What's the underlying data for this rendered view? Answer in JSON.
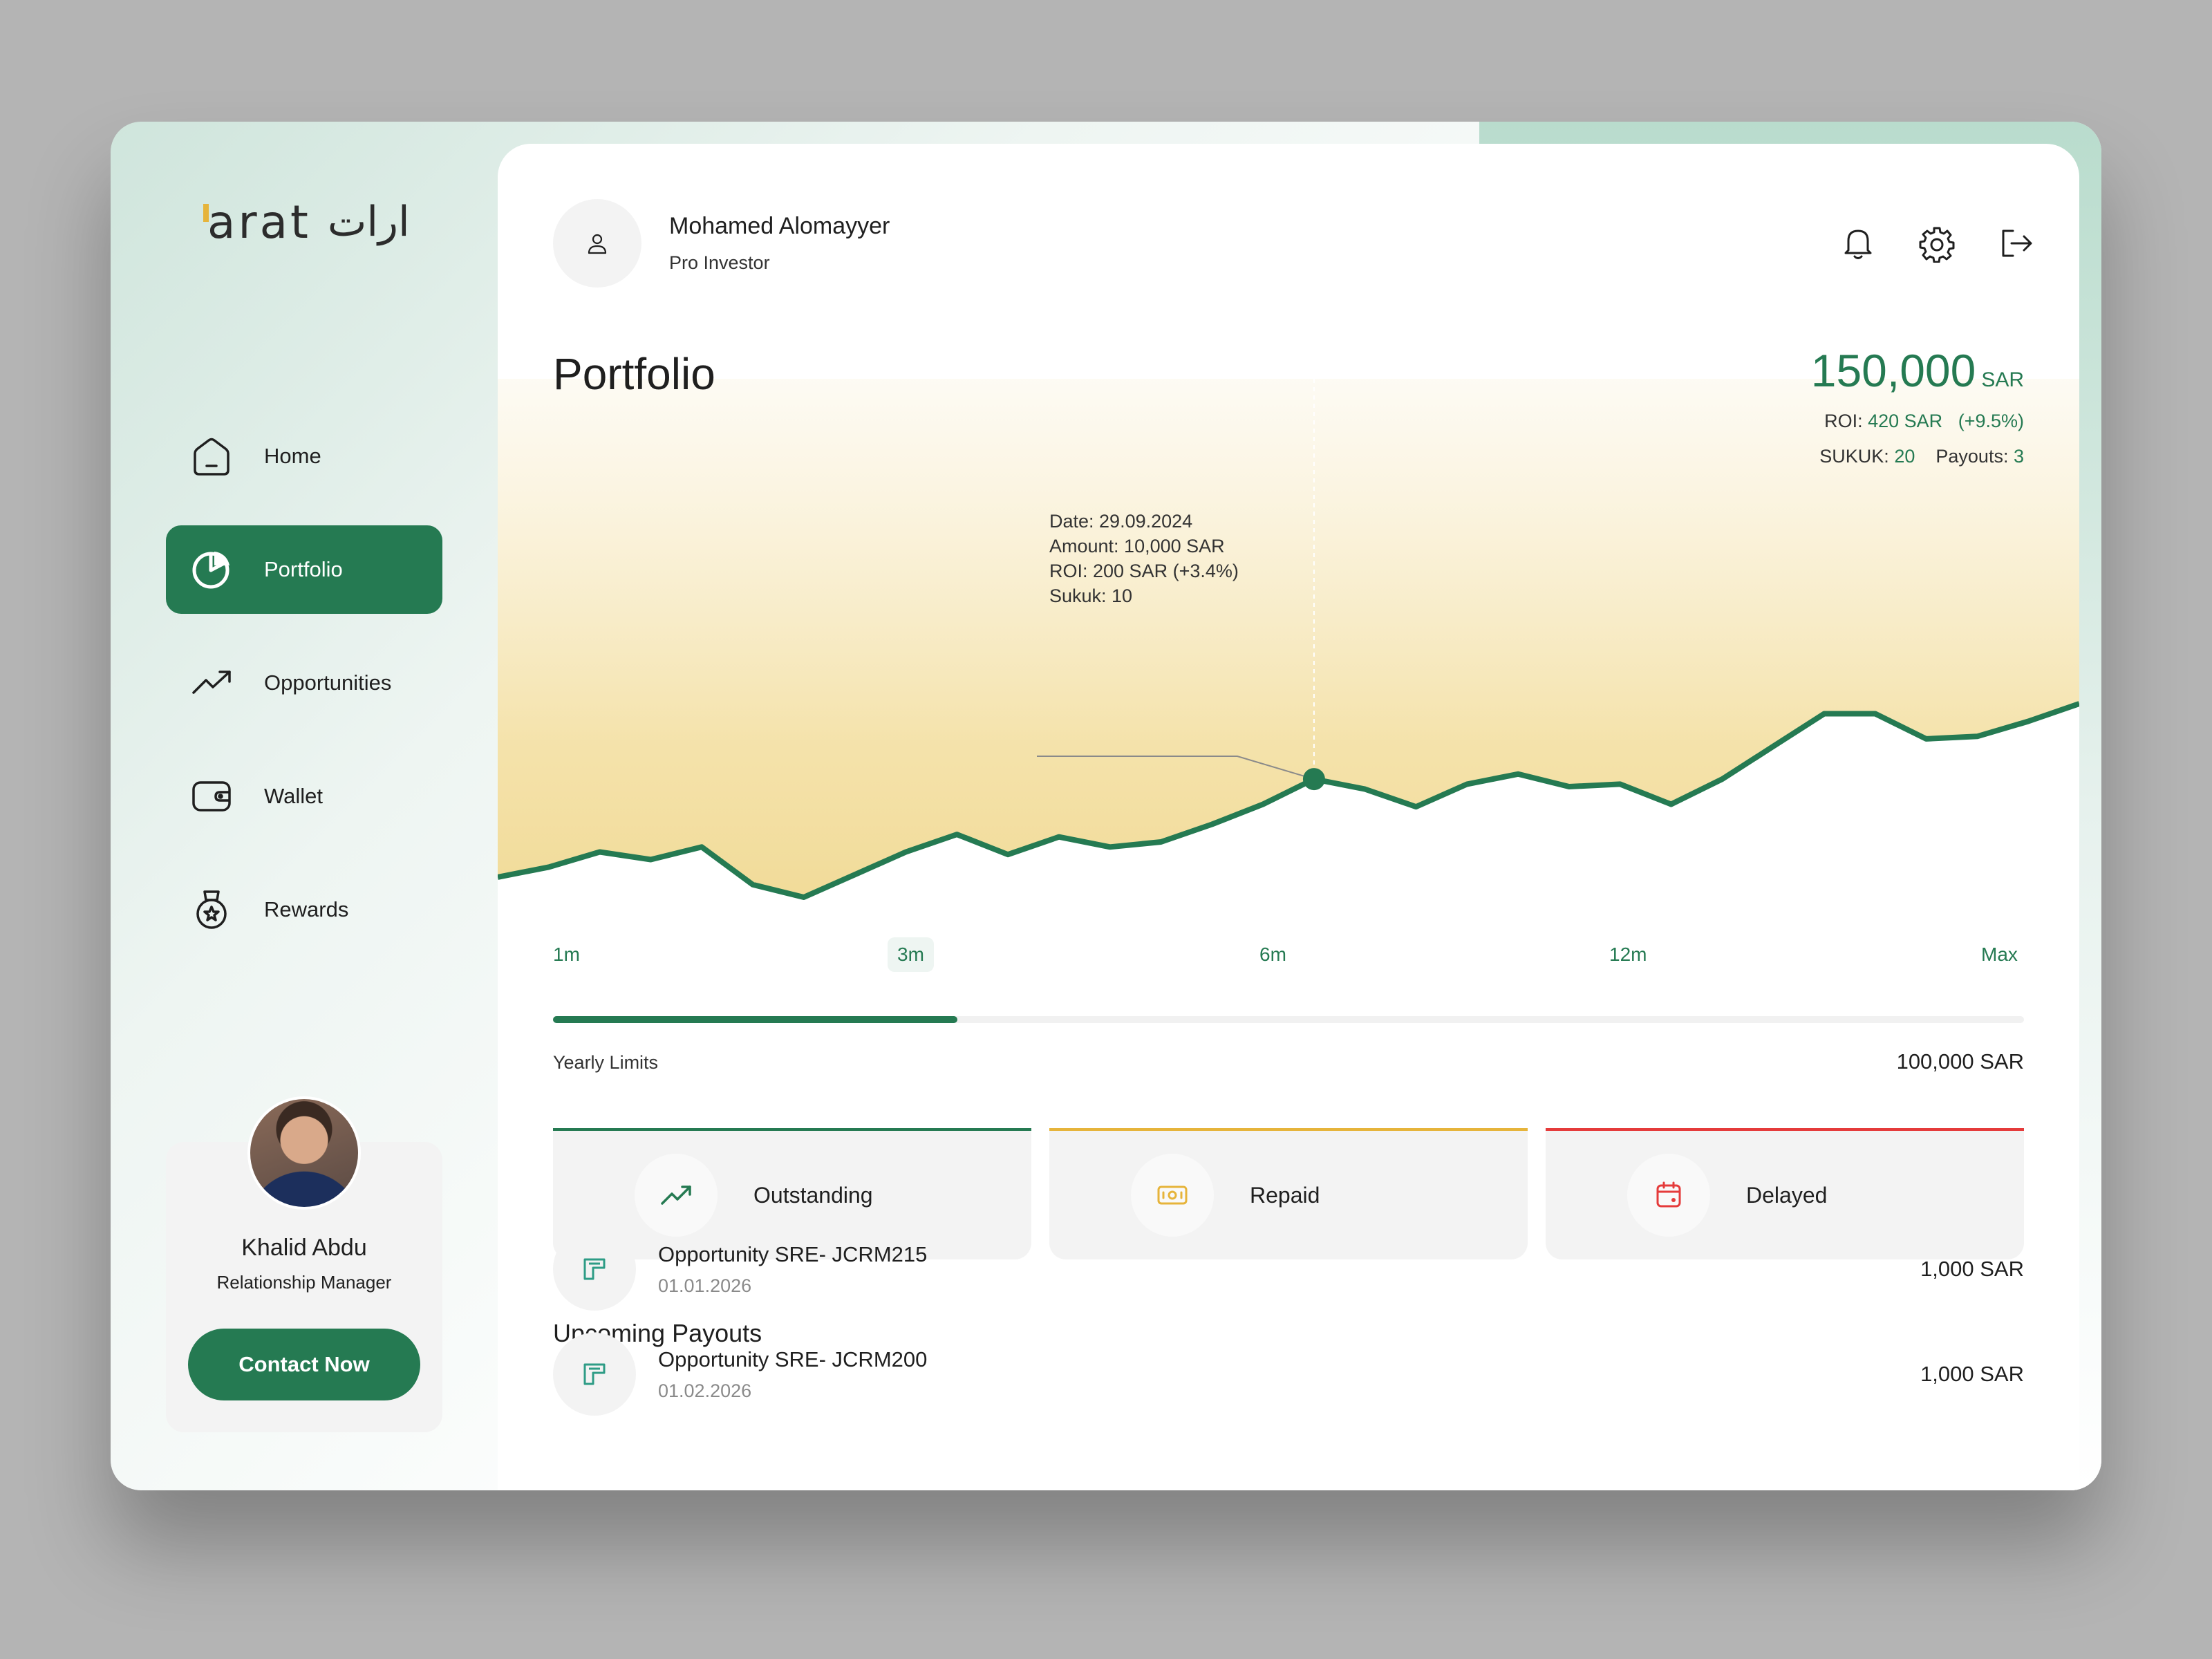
{
  "app": {
    "logo_latin": "arat",
    "logo_arabic": "ارات"
  },
  "sidebar": {
    "items": [
      {
        "label": "Home",
        "icon": "home-icon",
        "active": false
      },
      {
        "label": "Portfolio",
        "icon": "pie-chart-icon",
        "active": true
      },
      {
        "label": "Opportunities",
        "icon": "trending-up-icon",
        "active": false
      },
      {
        "label": "Wallet",
        "icon": "wallet-icon",
        "active": false
      },
      {
        "label": "Rewards",
        "icon": "medal-icon",
        "active": false
      }
    ],
    "manager": {
      "name": "Khalid Abdu",
      "role": "Relationship Manager",
      "contact_label": "Contact Now"
    }
  },
  "header": {
    "user_name": "Mohamed Alomayyer",
    "user_role": "Pro Investor",
    "icons": [
      "bell-icon",
      "settings-icon",
      "logout-icon"
    ]
  },
  "portfolio": {
    "title": "Portfolio",
    "total_value": "150,000",
    "currency": "SAR",
    "roi_label": "ROI:",
    "roi_value": "420 SAR",
    "roi_percent": "(+9.5%)",
    "sukuk_label": "SUKUK:",
    "sukuk_value": "20",
    "payouts_label": "Payouts:",
    "payouts_value": "3"
  },
  "tooltip": {
    "date": "Date: 29.09.2024",
    "amount": "Amount: 10,000 SAR",
    "roi": "ROI: 200 SAR (+3.4%)",
    "sukuk": "Sukuk: 10"
  },
  "ranges": [
    {
      "label": "1m",
      "active": false
    },
    {
      "label": "3m",
      "active": true
    },
    {
      "label": "6m",
      "active": false
    },
    {
      "label": "12m",
      "active": false
    },
    {
      "label": "Max",
      "active": false
    }
  ],
  "limits": {
    "label": "Yearly Limits",
    "value": "100,000 SAR",
    "progress": 0.275
  },
  "status_cards": [
    {
      "label": "Outstanding",
      "icon": "trending-up-icon",
      "color": "#257a52"
    },
    {
      "label": "Repaid",
      "icon": "banknote-icon",
      "color": "#e6b43b"
    },
    {
      "label": "Delayed",
      "icon": "calendar-icon",
      "color": "#e53b3b"
    }
  ],
  "payouts": {
    "title": "Upcoming Payouts",
    "items": [
      {
        "name": "Opportunity SRE- JCRM215",
        "date": "01.01.2026",
        "amount": "1,000 SAR"
      },
      {
        "name": "Opportunity SRE- JCRM200",
        "date": "01.02.2026",
        "amount": "1,000 SAR"
      }
    ]
  },
  "colors": {
    "accent": "#257a52",
    "gold": "#e6b43b",
    "red": "#e53b3b"
  },
  "chart_data": {
    "type": "area",
    "values": [
      3,
      7,
      13,
      10,
      15,
      0,
      -5,
      4,
      13,
      20,
      12,
      19,
      15,
      17,
      24,
      32,
      42,
      38,
      31,
      40,
      44,
      39,
      40,
      32,
      42,
      55,
      68,
      68,
      58,
      59,
      65,
      72
    ],
    "highlight_index": 16
  }
}
